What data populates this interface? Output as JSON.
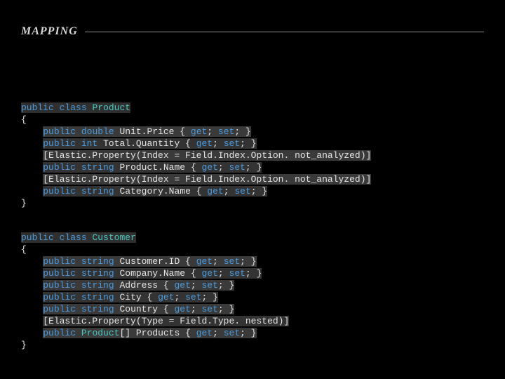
{
  "header": {
    "title": "MAPPING"
  },
  "product": {
    "decl_public": "public",
    "decl_class": "class",
    "name": "Product",
    "open": "{",
    "p1": {
      "kw": "public",
      "ty": "double",
      "id": "Unit.Price",
      "get": "get",
      "set": "set"
    },
    "p2": {
      "kw": "public",
      "ty": "int",
      "id": "Total.Quantity",
      "get": "get",
      "set": "set"
    },
    "attr1": "[Elastic.Property(Index = Field.Index.Option. not_analyzed)]",
    "p3": {
      "kw": "public",
      "ty": "string",
      "id": "Product.Name",
      "get": "get",
      "set": "set"
    },
    "attr2": "[Elastic.Property(Index = Field.Index.Option. not_analyzed)]",
    "p4": {
      "kw": "public",
      "ty": "string",
      "id": "Category.Name",
      "get": "get",
      "set": "set"
    },
    "close": "}"
  },
  "customer": {
    "decl_public": "public",
    "decl_class": "class",
    "name": "Customer",
    "open": "{",
    "p1": {
      "kw": "public",
      "ty": "string",
      "id": "Customer.ID",
      "get": "get",
      "set": "set"
    },
    "p2": {
      "kw": "public",
      "ty": "string",
      "id": "Company.Name",
      "get": "get",
      "set": "set"
    },
    "p3": {
      "kw": "public",
      "ty": "string",
      "id": "Address",
      "get": "get",
      "set": "set"
    },
    "p4": {
      "kw": "public",
      "ty": "string",
      "id": "City",
      "get": "get",
      "set": "set"
    },
    "p5": {
      "kw": "public",
      "ty": "string",
      "id": "Country",
      "get": "get",
      "set": "set"
    },
    "attr1": "[Elastic.Property(Type = Field.Type. nested)]",
    "p6": {
      "kw": "public",
      "ty": "Product",
      "arr": "[]",
      "id": "Products",
      "get": "get",
      "set": "set"
    },
    "close": "}"
  }
}
